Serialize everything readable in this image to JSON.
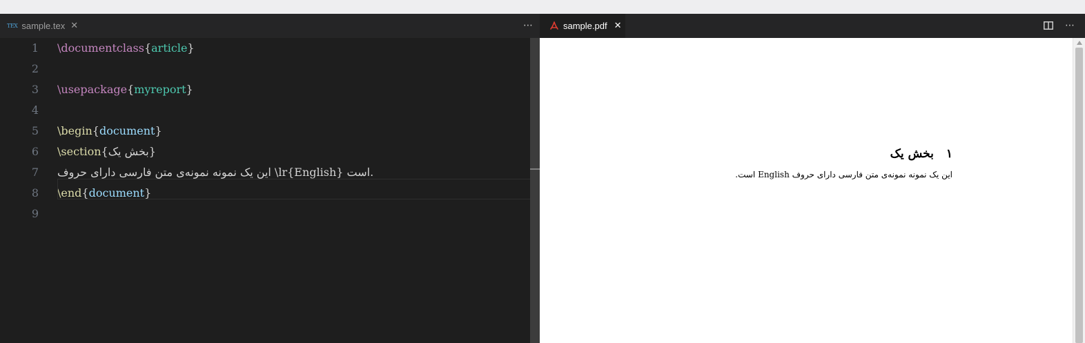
{
  "left_editor": {
    "tab": {
      "icon_text": "TEX",
      "label": "sample.tex",
      "close_glyph": "✕"
    },
    "more_glyph": "⋯",
    "line_numbers": [
      "1",
      "2",
      "3",
      "4",
      "5",
      "6",
      "7",
      "8",
      "9"
    ],
    "lines": {
      "l1": {
        "cmd": "\\documentclass",
        "open": "{",
        "arg": "article",
        "close": "}"
      },
      "l3": {
        "cmd": "\\usepackage",
        "open": "{",
        "arg": "myreport",
        "close": "}"
      },
      "l5": {
        "cmd": "\\begin",
        "open": "{",
        "arg": "document",
        "close": "}"
      },
      "l6": {
        "cmd": "\\section",
        "open": "{",
        "arg": "بخش یک",
        "close": "}"
      },
      "l7": {
        "text": "این یک نمونه نمونه‌ی متن فارسی دارای حروف \\lr{English} است."
      },
      "l8": {
        "cmd": "\\end",
        "open": "{",
        "arg": "document",
        "close": "}"
      }
    }
  },
  "right_viewer": {
    "tab": {
      "label": "sample.pdf",
      "close_glyph": "✕"
    },
    "split_icon": "split-editor-icon",
    "more_glyph": "⋯",
    "pdf": {
      "section_number": "۱",
      "section_title": "بخش یک",
      "body_text": "این یک نمونه نمونه‌ی متن فارسی دارای حروف English است."
    }
  },
  "colors": {
    "editor_bg": "#1e1e1e",
    "tabbar_bg": "#252526",
    "command": "#c586c0",
    "argument": "#4ec9b0",
    "pdf_icon": "#e03c31"
  }
}
